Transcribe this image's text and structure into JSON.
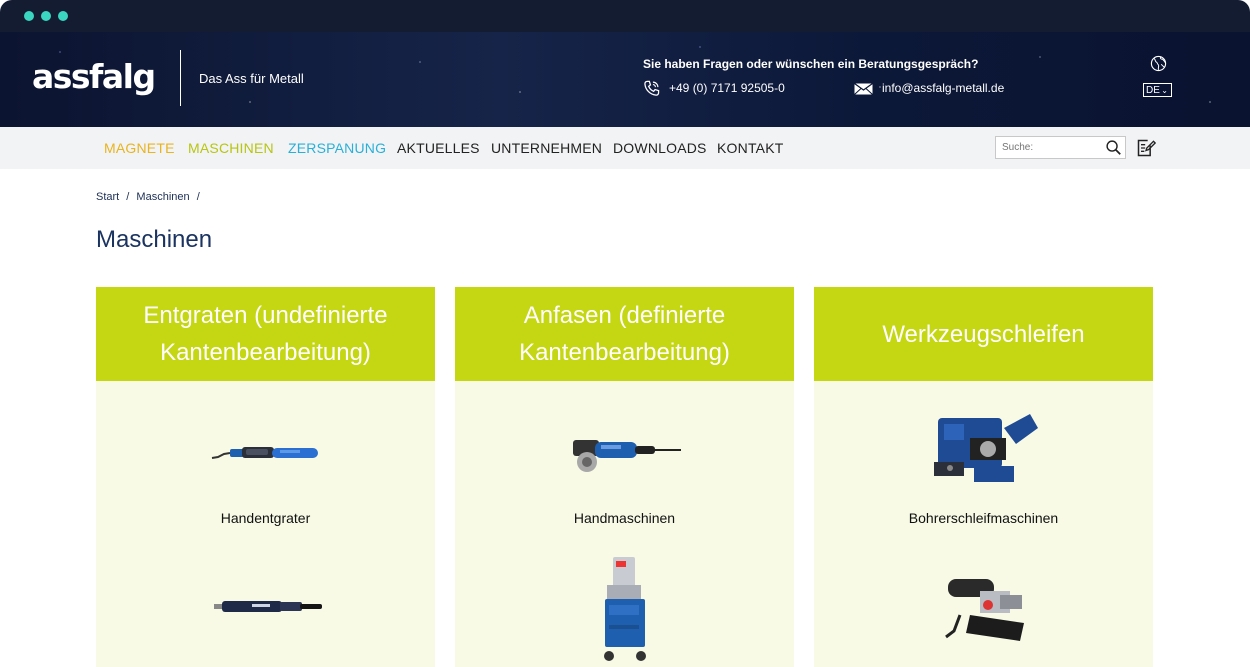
{
  "header": {
    "tagline": "Das Ass für Metall",
    "question": "Sie haben Fragen oder wünschen ein Beratungsgespräch?",
    "phone": "+49 (0) 7171 92505-0",
    "email": "info@assfalg-metall.de",
    "language": "DE",
    "logo_text": "assfalg"
  },
  "nav": {
    "items": [
      {
        "label": "MAGNETE",
        "color": "#e8b420"
      },
      {
        "label": "MASCHINEN",
        "color": "#b8c512"
      },
      {
        "label": "ZERSPANUNG",
        "color": "#2ab0d8"
      },
      {
        "label": "AKTUELLES",
        "color": "#222222"
      },
      {
        "label": "UNTERNEHMEN",
        "color": "#222222"
      },
      {
        "label": "DOWNLOADS",
        "color": "#222222"
      },
      {
        "label": "KONTAKT",
        "color": "#222222"
      }
    ],
    "search_placeholder": "Suche:"
  },
  "breadcrumb": {
    "items": [
      "Start",
      "/",
      "Maschinen",
      "/"
    ]
  },
  "page_title": "Maschinen",
  "categories": [
    {
      "title": "Entgraten (undefinierte Kantenbearbeitung)",
      "items": [
        {
          "label": "Handentgrater",
          "icon": "deburring-tool-image"
        },
        {
          "label": "",
          "icon": "grinder-pen-image"
        }
      ]
    },
    {
      "title": "Anfasen (definierte Kantenbearbeitung)",
      "items": [
        {
          "label": "Handmaschinen",
          "icon": "hand-chamfering-machine-image"
        },
        {
          "label": "",
          "icon": "stationary-chamfering-machine-image"
        }
      ]
    },
    {
      "title": "Werkzeugschleifen",
      "items": [
        {
          "label": "Bohrerschleifmaschinen",
          "icon": "drill-grinding-machine-image"
        },
        {
          "label": "",
          "icon": "grinding-device-image"
        }
      ]
    }
  ],
  "colors": {
    "accent_green": "#c5d612",
    "card_bg": "#f8fae6",
    "header_bg": "#0a1633",
    "title_blue": "#1a3360"
  }
}
